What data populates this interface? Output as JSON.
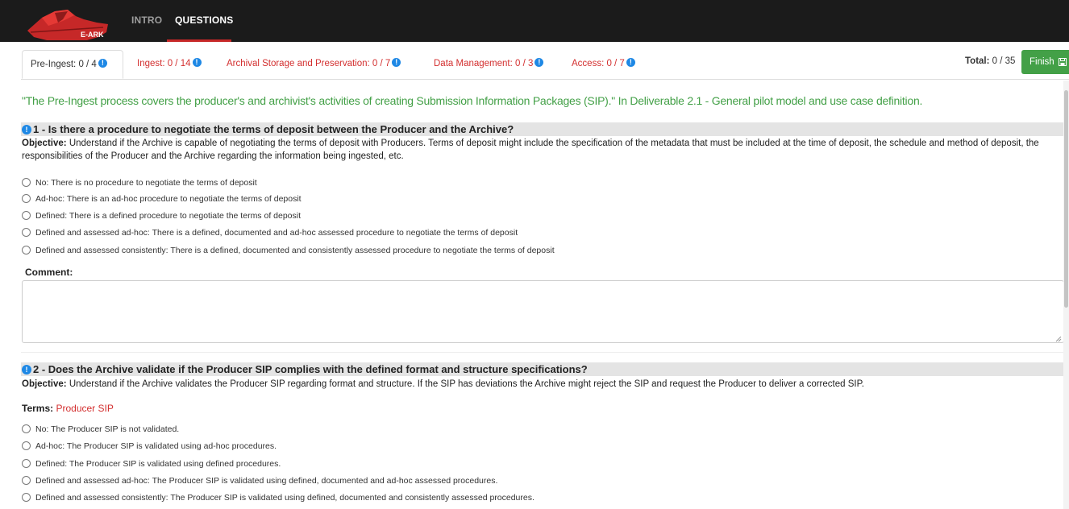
{
  "brand": {
    "name": "E-ARK",
    "color": "#c62828"
  },
  "nav": {
    "items": [
      {
        "label": "INTRO"
      },
      {
        "label": "QUESTIONS"
      }
    ]
  },
  "tabs": [
    {
      "label": "Pre-Ingest: 0 / 4",
      "icon": "info-icon"
    },
    {
      "label": "Ingest: 0 / 14",
      "icon": "info-icon"
    },
    {
      "label": "Archival Storage and Preservation: 0 / 7",
      "icon": "info-icon"
    },
    {
      "label": "Data Management: 0 / 3",
      "icon": "info-icon"
    },
    {
      "label": "Access: 0 / 7",
      "icon": "info-icon"
    }
  ],
  "total": {
    "label": "Total:",
    "value": "0 / 35"
  },
  "finish_button": {
    "label": "Finish",
    "icon": "save-icon"
  },
  "intro_text": "\"The Pre-Ingest process covers the producer's and archivist's activities of creating Submission Information Packages (SIP).\" In Deliverable 2.1 - General pilot model and use case definition.",
  "questions": [
    {
      "title": "1 - Is there a procedure to negotiate the terms of deposit between the Producer and the Archive?",
      "objective_label": "Objective:",
      "objective": "Understand if the Archive is capable of negotiating the terms of deposit with Producers. Terms of deposit might include the specification of the metadata that must be included at the time of deposit, the schedule and method of deposit, the responsibilities of the Producer and the Archive regarding the information being ingested, etc.",
      "options": [
        "No: There is no procedure to negotiate the terms of deposit",
        "Ad-hoc: There is an ad-hoc procedure to negotiate the terms of deposit",
        "Defined: There is a defined procedure to negotiate the terms of deposit",
        "Defined and assessed ad-hoc: There is a defined, documented and ad-hoc assessed procedure to negotiate the terms of deposit",
        "Defined and assessed consistently: There is a defined, documented and consistently assessed procedure to negotiate the terms of deposit"
      ],
      "comment_label": "Comment:",
      "comment_value": ""
    },
    {
      "title": "2 - Does the Archive validate if the Producer SIP complies with the defined format and structure specifications?",
      "objective_label": "Objective:",
      "objective": "Understand if the Archive validates the Producer SIP regarding format and structure. If the SIP has deviations the Archive might reject the SIP and request the Producer to deliver a corrected SIP.",
      "terms_label": "Terms:",
      "terms": "Producer SIP",
      "options": [
        "No: The Producer SIP is not validated.",
        "Ad-hoc: The Producer SIP is validated using ad-hoc procedures.",
        "Defined: The Producer SIP is validated using defined procedures.",
        "Defined and assessed ad-hoc: The Producer SIP is validated using defined, documented and ad-hoc assessed procedures.",
        "Defined and assessed consistently: The Producer SIP is validated using defined, documented and consistently assessed procedures."
      ]
    }
  ],
  "colors": {
    "topbar": "#1b1b1b",
    "accent": "#c62828",
    "success": "#43a047",
    "info": "#1e88e5",
    "inactive_tab": "#d32f2f"
  }
}
